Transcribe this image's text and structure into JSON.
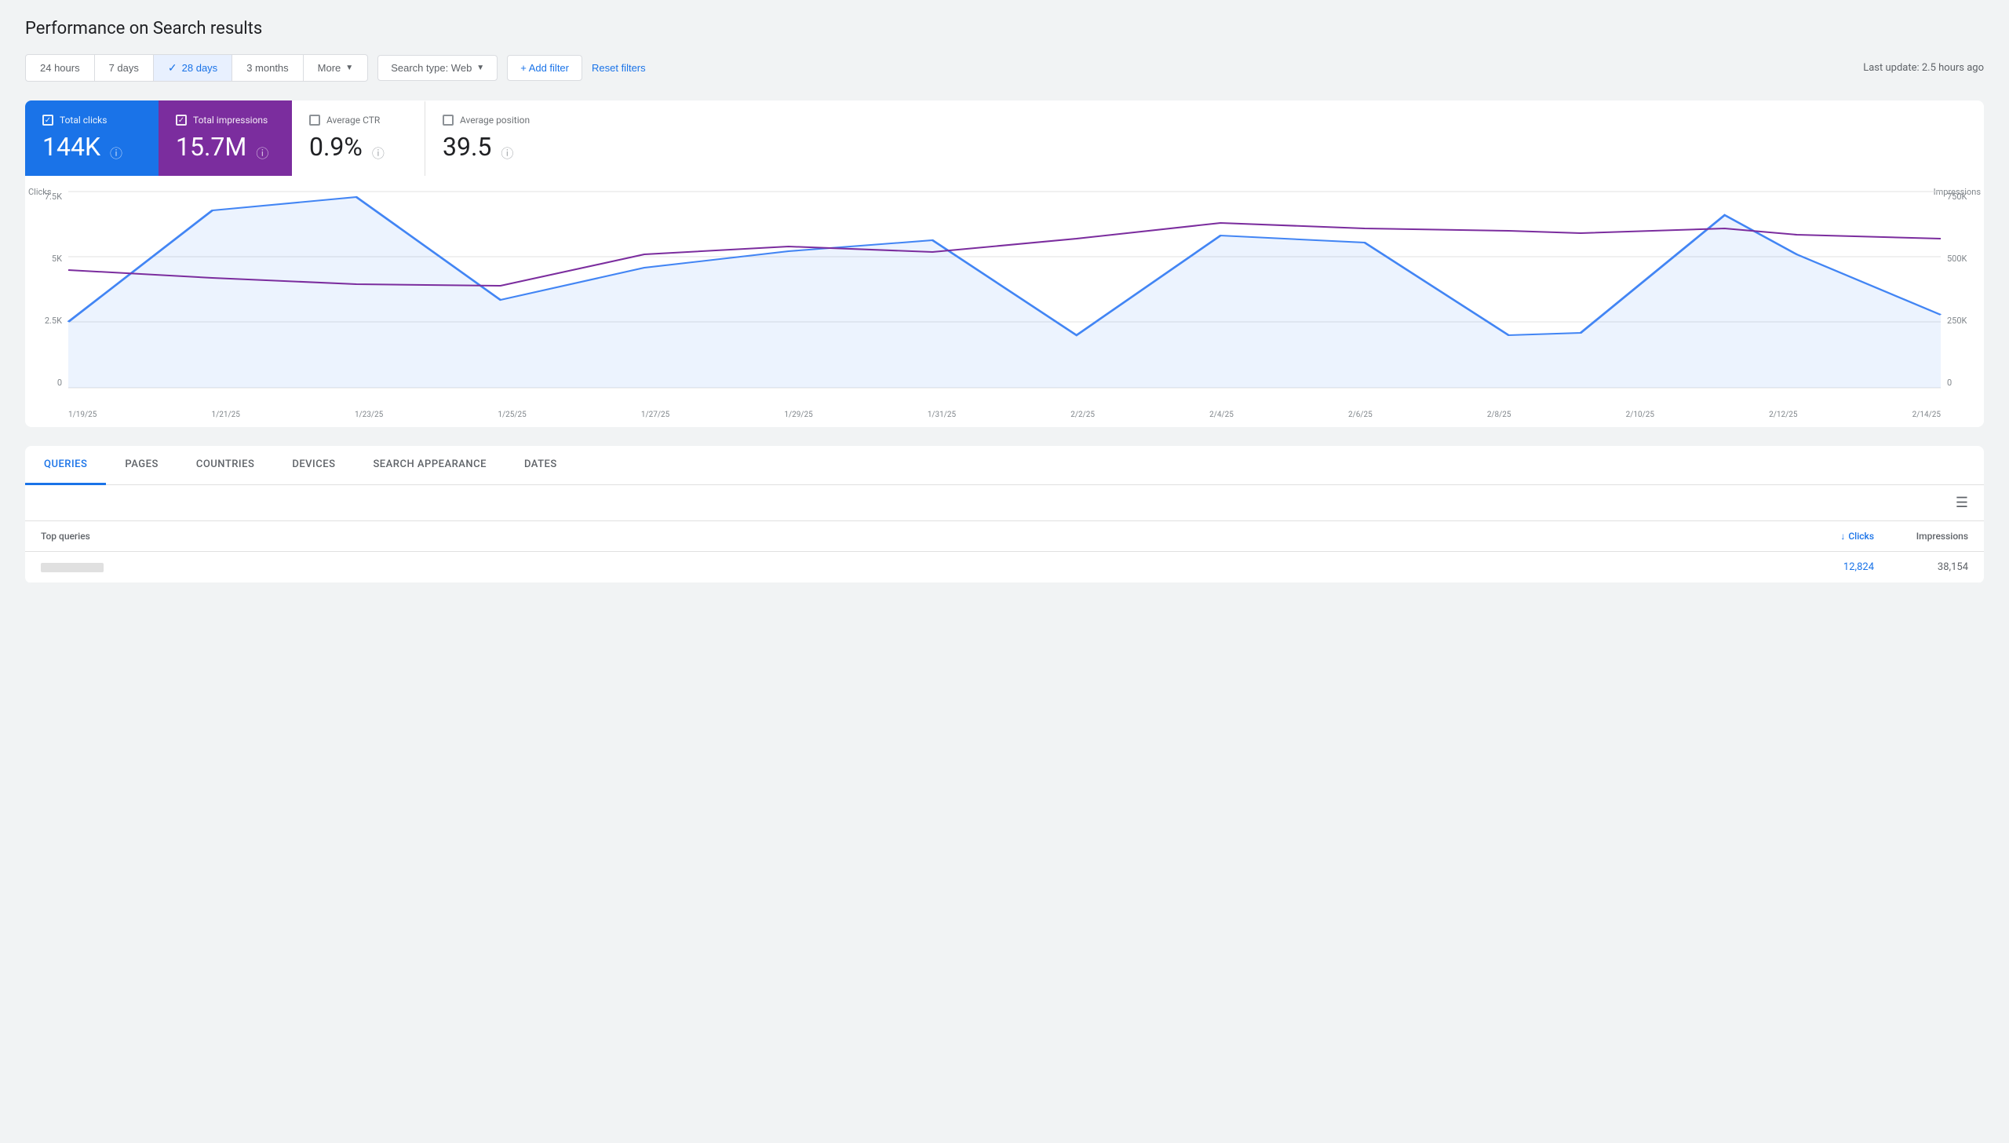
{
  "page": {
    "title": "Performance on Search results"
  },
  "toolbar": {
    "date_options": [
      {
        "label": "24 hours",
        "active": false
      },
      {
        "label": "7 days",
        "active": false
      },
      {
        "label": "28 days",
        "active": true
      },
      {
        "label": "3 months",
        "active": false
      },
      {
        "label": "More",
        "active": false
      }
    ],
    "search_type_label": "Search type: Web",
    "add_filter_label": "+ Add filter",
    "reset_label": "Reset filters",
    "last_update": "Last update: 2.5 hours ago"
  },
  "metrics": [
    {
      "id": "clicks",
      "label": "Total clicks",
      "value": "144K",
      "active": true,
      "style": "blue"
    },
    {
      "id": "impressions",
      "label": "Total impressions",
      "value": "15.7M",
      "active": true,
      "style": "purple"
    },
    {
      "id": "ctr",
      "label": "Average CTR",
      "value": "0.9%",
      "active": false,
      "style": "inactive"
    },
    {
      "id": "position",
      "label": "Average position",
      "value": "39.5",
      "active": false,
      "style": "inactive"
    }
  ],
  "chart": {
    "y_left_labels": [
      "7.5K",
      "5K",
      "2.5K",
      "0"
    ],
    "y_right_labels": [
      "750K",
      "500K",
      "250K",
      "0"
    ],
    "y_left_title": "Clicks",
    "y_right_title": "Impressions",
    "x_labels": [
      "1/19/25",
      "1/21/25",
      "1/23/25",
      "1/25/25",
      "1/27/25",
      "1/29/25",
      "1/31/25",
      "2/2/25",
      "2/4/25",
      "2/6/25",
      "2/8/25",
      "2/10/25",
      "2/12/25",
      "2/14/25"
    ]
  },
  "tabs": [
    {
      "label": "QUERIES",
      "active": true
    },
    {
      "label": "PAGES",
      "active": false
    },
    {
      "label": "COUNTRIES",
      "active": false
    },
    {
      "label": "DEVICES",
      "active": false
    },
    {
      "label": "SEARCH APPEARANCE",
      "active": false
    },
    {
      "label": "DATES",
      "active": false
    }
  ],
  "table": {
    "header_query": "Top queries",
    "header_clicks": "Clicks",
    "header_impressions": "Impressions",
    "rows": [
      {
        "clicks": "12,824",
        "impressions": "38,154"
      }
    ]
  }
}
